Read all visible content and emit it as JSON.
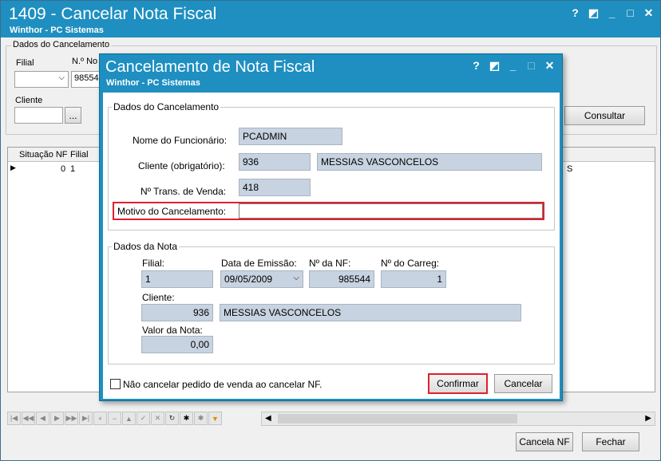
{
  "main": {
    "title": "1409 - Cancelar Nota Fiscal",
    "subtitle": "Winthor - PC Sistemas",
    "window_buttons": [
      "?",
      "◩",
      "_",
      "□",
      "✕"
    ],
    "group_label": "Dados do Cancelamento",
    "filial_label": "Filial",
    "nota_label": "N.º No",
    "nota_value": "98554",
    "cliente_label": "Cliente",
    "lookup_button": "...",
    "consultar_button": "Consultar",
    "grid": {
      "columns": [
        "Situação NF",
        "Filial"
      ],
      "row": {
        "situacao": "0",
        "filial": "1"
      },
      "right_text": "S"
    },
    "cancela_nf_button": "Cancela NF",
    "fechar_button": "Fechar"
  },
  "dialog": {
    "title": "Cancelamento de Nota Fiscal",
    "subtitle": "Winthor - PC Sistemas",
    "window_buttons": [
      "?",
      "◩",
      "_",
      "□",
      "✕"
    ],
    "group1_label": "Dados do Cancelamento",
    "funcionario_label": "Nome do Funcionário:",
    "funcionario_value": "PCADMIN",
    "cliente_label": "Cliente (obrigatório):",
    "cliente_code": "936",
    "cliente_name": "MESSIAS VASCONCELOS",
    "trans_label": "Nº Trans. de Venda:",
    "trans_value": "418",
    "motivo_label": "Motivo do Cancelamento:",
    "motivo_value": "",
    "group2_label": "Dados da Nota",
    "filial_label": "Filial:",
    "filial_value": "1",
    "emissao_label": "Data de Emissão:",
    "emissao_value": "09/05/2009",
    "nf_label": "Nº da NF:",
    "nf_value": "985544",
    "carreg_label": "Nº do Carreg:",
    "carreg_value": "1",
    "nota_cliente_label": "Cliente:",
    "nota_cliente_code": "936",
    "nota_cliente_name": "MESSIAS VASCONCELOS",
    "valor_label": "Valor da Nota:",
    "valor_value": "0,00",
    "checkbox_label": "Não cancelar pedido de venda ao cancelar NF.",
    "confirmar_button": "Confirmar",
    "cancelar_button": "Cancelar"
  },
  "colors": {
    "titlebar": "#1e8fc0",
    "field_bg": "#c7d3e0",
    "highlight": "#e0202a"
  }
}
